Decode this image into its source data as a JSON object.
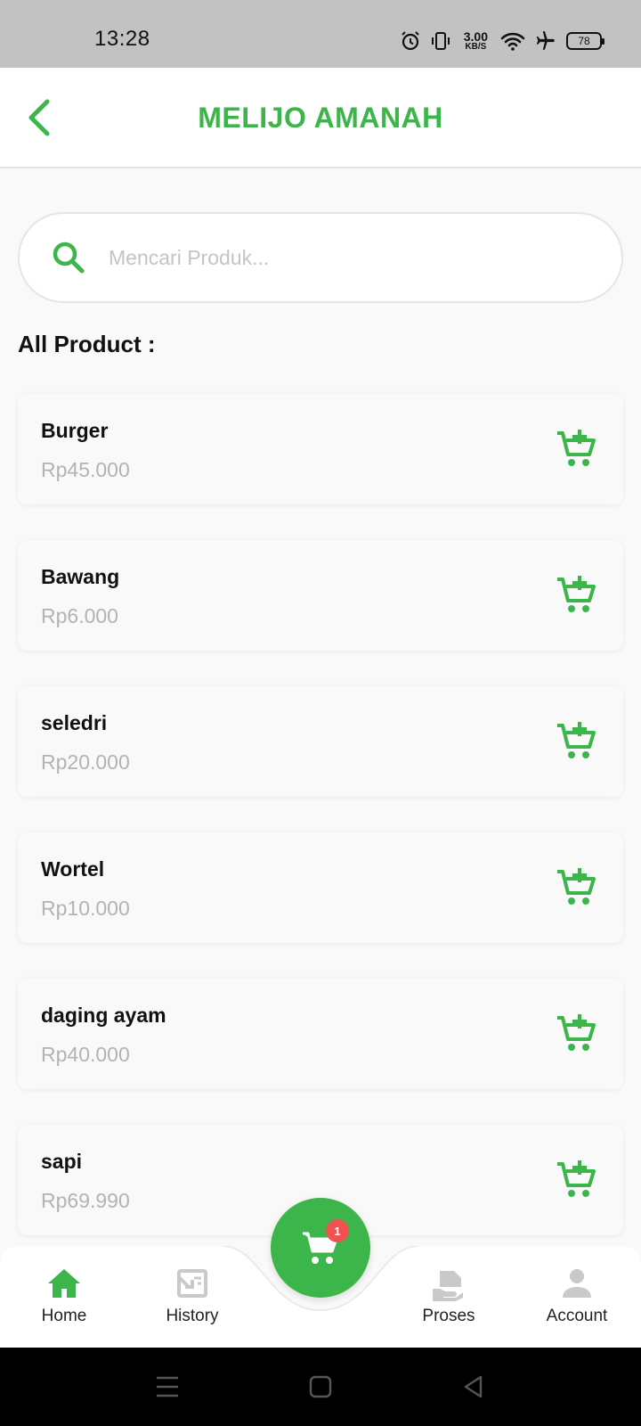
{
  "status_bar": {
    "time": "13:28",
    "net_speed_value": "3.00",
    "net_speed_unit": "KB/S",
    "battery": "78",
    "icons": [
      "alarm-icon",
      "vibrate-icon",
      "wifi-icon",
      "airplane-icon",
      "battery-icon"
    ]
  },
  "header": {
    "title": "MELIJO AMANAH",
    "back_icon": "back-chevron-icon"
  },
  "search": {
    "placeholder": "Mencari Produk...",
    "value": ""
  },
  "section_title": "All Product :",
  "products": [
    {
      "name": "Burger",
      "price": "Rp45.000"
    },
    {
      "name": "Bawang",
      "price": "Rp6.000"
    },
    {
      "name": "seledri",
      "price": "Rp20.000"
    },
    {
      "name": "Wortel",
      "price": "Rp10.000"
    },
    {
      "name": "daging ayam",
      "price": "Rp40.000"
    },
    {
      "name": "sapi",
      "price": "Rp69.990"
    }
  ],
  "bottom_nav": {
    "items": [
      {
        "label": "Home",
        "icon": "home-icon",
        "active": true
      },
      {
        "label": "History",
        "icon": "history-icon",
        "active": false
      },
      {
        "label": "Proses",
        "icon": "proses-icon",
        "active": false
      },
      {
        "label": "Account",
        "icon": "account-icon",
        "active": false
      }
    ],
    "cart_badge": "1"
  },
  "colors": {
    "accent": "#3cb54a",
    "badge": "#f05252",
    "inactive_icon": "#c9c9c9"
  }
}
